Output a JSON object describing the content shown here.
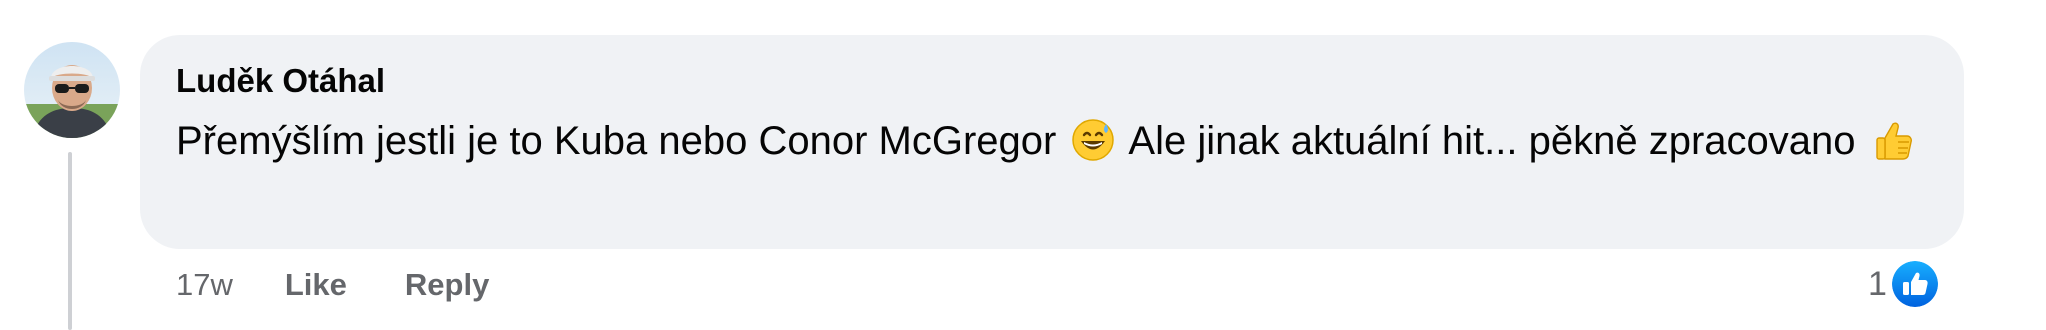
{
  "comment": {
    "author": "Luděk Otáhal",
    "text_part1": "Přemýšlím jestli je to Kuba nebo Conor McGregor",
    "emoji1": "grinning-sweat-emoji",
    "text_part2": "Ale jinak aktuální hit... pěkně zpracovano",
    "emoji2": "thumbs-up-emoji",
    "time": "17w",
    "like_label": "Like",
    "reply_label": "Reply",
    "reaction_count": "1",
    "reaction_icon": "like-reaction-icon"
  },
  "colors": {
    "bubble": "#f0f2f5",
    "text": "#050505",
    "meta": "#65676b",
    "like_blue": "#1877f2"
  }
}
